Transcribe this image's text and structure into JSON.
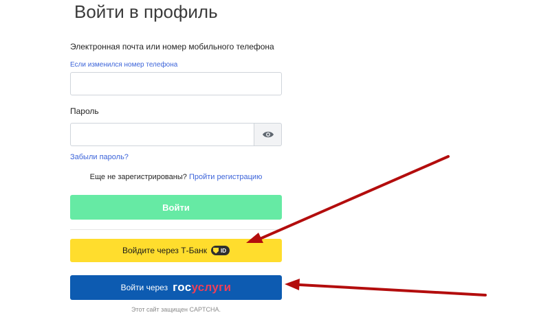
{
  "page": {
    "title": "Войти в профиль"
  },
  "form": {
    "email_label": "Электронная почта или номер мобильного телефона",
    "phone_changed_link": "Если изменился номер телефона",
    "email_value": "",
    "password_label": "Пароль",
    "password_value": "",
    "forgot_password_link": "Забыли пароль?",
    "register_prompt": "Еще не зарегистрированы?",
    "register_link": "Пройти регистрацию",
    "login_button": "Войти"
  },
  "alt_login": {
    "tbank_button": "Войдите через Т-Банк",
    "tbank_badge": "ID",
    "gosuslugi_button_prefix": "Войти через",
    "gosuslugi_logo_part1": "гос",
    "gosuslugi_logo_part2": "услуги",
    "captcha_notice": "Этот сайт защищен CAPTCHA."
  },
  "colors": {
    "login_button": "#66eaa4",
    "tbank_button": "#ffdd2d",
    "gosuslugi_button": "#0d5bb1",
    "link": "#3b63d9",
    "annotation_arrow": "#b30d0d"
  },
  "icons": {
    "show_password": "eye-icon",
    "tbank_id": "shield-icon"
  }
}
